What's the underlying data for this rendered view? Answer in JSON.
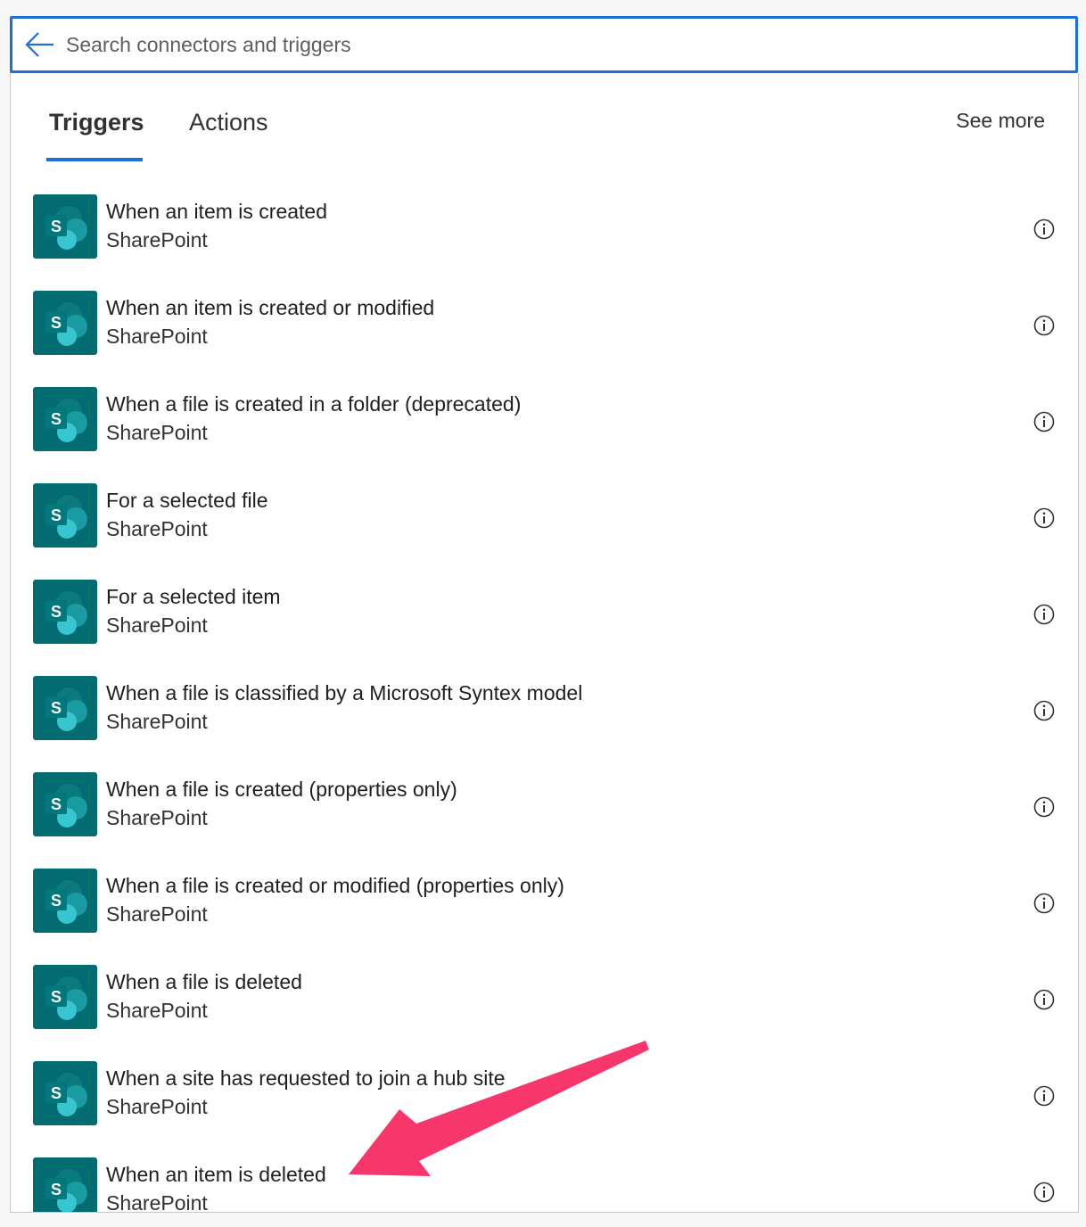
{
  "search": {
    "placeholder": "Search connectors and triggers"
  },
  "tabs": [
    {
      "label": "Triggers",
      "active": true
    },
    {
      "label": "Actions",
      "active": false
    }
  ],
  "see_more_label": "See more",
  "items": [
    {
      "title": "When an item is created",
      "connector": "SharePoint"
    },
    {
      "title": "When an item is created or modified",
      "connector": "SharePoint"
    },
    {
      "title": "When a file is created in a folder (deprecated)",
      "connector": "SharePoint"
    },
    {
      "title": "For a selected file",
      "connector": "SharePoint"
    },
    {
      "title": "For a selected item",
      "connector": "SharePoint"
    },
    {
      "title": "When a file is classified by a Microsoft Syntex model",
      "connector": "SharePoint"
    },
    {
      "title": "When a file is created (properties only)",
      "connector": "SharePoint"
    },
    {
      "title": "When a file is created or modified (properties only)",
      "connector": "SharePoint"
    },
    {
      "title": "When a file is deleted",
      "connector": "SharePoint"
    },
    {
      "title": "When a site has requested to join a hub site",
      "connector": "SharePoint"
    },
    {
      "title": "When an item is deleted",
      "connector": "SharePoint"
    }
  ],
  "icons": {
    "back": "arrow-left-icon",
    "connector": "sharepoint-logo-icon",
    "info": "info-icon",
    "letter": "S"
  },
  "colors": {
    "accent": "#1f6fd8",
    "sharepoint": "#036c70",
    "annotation_arrow": "#f7366b"
  }
}
